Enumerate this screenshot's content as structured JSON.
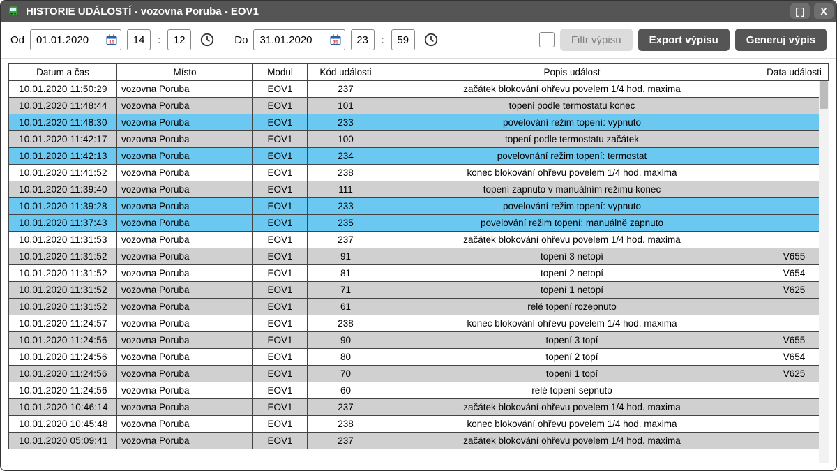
{
  "window": {
    "title": "HISTORIE UDÁLOSTÍ - vozovna Poruba - EOV1"
  },
  "toolbar": {
    "from_label": "Od",
    "from_date": "01.01.2020",
    "from_h": "14",
    "from_m": "12",
    "to_label": "Do",
    "to_date": "31.01.2020",
    "to_h": "23",
    "to_m": "59",
    "filter_label": "Filtr výpisu",
    "export_label": "Export výpisu",
    "generate_label": "Generuj výpis"
  },
  "columns": {
    "datetime": "Datum a čas",
    "place": "Místo",
    "module": "Modul",
    "code": "Kód události",
    "desc": "Popis událost",
    "data": "Data události"
  },
  "rows": [
    {
      "dt": "10.01.2020  11:50:29",
      "pl": "vozovna Poruba",
      "md": "EOV1",
      "cd": "237",
      "de": "začátek blokování ohřevu povelem 1/4 hod. maxima",
      "da": "",
      "hl": "none"
    },
    {
      "dt": "10.01.2020  11:48:44",
      "pl": "vozovna Poruba",
      "md": "EOV1",
      "cd": "101",
      "de": "topeni podle termostatu konec",
      "da": "",
      "hl": "band"
    },
    {
      "dt": "10.01.2020  11:48:30",
      "pl": "vozovna Poruba",
      "md": "EOV1",
      "cd": "233",
      "de": "povelování režim topení: vypnuto",
      "da": "",
      "hl": "blue"
    },
    {
      "dt": "10.01.2020  11:42:17",
      "pl": "vozovna Poruba",
      "md": "EOV1",
      "cd": "100",
      "de": "topení podle termostatu začátek",
      "da": "",
      "hl": "band"
    },
    {
      "dt": "10.01.2020  11:42:13",
      "pl": "vozovna Poruba",
      "md": "EOV1",
      "cd": "234",
      "de": "povelovnání režim topení: termostat",
      "da": "",
      "hl": "blue"
    },
    {
      "dt": "10.01.2020  11:41:52",
      "pl": "vozovna Poruba",
      "md": "EOV1",
      "cd": "238",
      "de": "konec blokování ohřevu povelem 1/4 hod. maxima",
      "da": "",
      "hl": "none"
    },
    {
      "dt": "10.01.2020  11:39:40",
      "pl": "vozovna Poruba",
      "md": "EOV1",
      "cd": "111",
      "de": "topení zapnuto v manuálním režimu konec",
      "da": "",
      "hl": "band"
    },
    {
      "dt": "10.01.2020  11:39:28",
      "pl": "vozovna Poruba",
      "md": "EOV1",
      "cd": "233",
      "de": "povelování režim topení: vypnuto",
      "da": "",
      "hl": "blue"
    },
    {
      "dt": "10.01.2020  11:37:43",
      "pl": "vozovna Poruba",
      "md": "EOV1",
      "cd": "235",
      "de": "povelování režim topení: manuálně zapnuto",
      "da": "",
      "hl": "blue"
    },
    {
      "dt": "10.01.2020  11:31:53",
      "pl": "vozovna Poruba",
      "md": "EOV1",
      "cd": "237",
      "de": "začátek blokování ohřevu povelem 1/4 hod. maxima",
      "da": "",
      "hl": "none"
    },
    {
      "dt": "10.01.2020  11:31:52",
      "pl": "vozovna Poruba",
      "md": "EOV1",
      "cd": "91",
      "de": "topení 3 netopí",
      "da": "V655",
      "hl": "band"
    },
    {
      "dt": "10.01.2020  11:31:52",
      "pl": "vozovna Poruba",
      "md": "EOV1",
      "cd": "81",
      "de": "topení 2 netopí",
      "da": "V654",
      "hl": "none"
    },
    {
      "dt": "10.01.2020  11:31:52",
      "pl": "vozovna Poruba",
      "md": "EOV1",
      "cd": "71",
      "de": "topení 1 netopí",
      "da": "V625",
      "hl": "band"
    },
    {
      "dt": "10.01.2020  11:31:52",
      "pl": "vozovna Poruba",
      "md": "EOV1",
      "cd": "61",
      "de": "relé topení rozepnuto",
      "da": "",
      "hl": "band"
    },
    {
      "dt": "10.01.2020  11:24:57",
      "pl": "vozovna Poruba",
      "md": "EOV1",
      "cd": "238",
      "de": "konec blokování ohřevu povelem 1/4 hod. maxima",
      "da": "",
      "hl": "none"
    },
    {
      "dt": "10.01.2020  11:24:56",
      "pl": "vozovna Poruba",
      "md": "EOV1",
      "cd": "90",
      "de": "topení 3 topí",
      "da": "V655",
      "hl": "band"
    },
    {
      "dt": "10.01.2020  11:24:56",
      "pl": "vozovna Poruba",
      "md": "EOV1",
      "cd": "80",
      "de": "topení 2 topí",
      "da": "V654",
      "hl": "none"
    },
    {
      "dt": "10.01.2020  11:24:56",
      "pl": "vozovna Poruba",
      "md": "EOV1",
      "cd": "70",
      "de": "topeni 1 topí",
      "da": "V625",
      "hl": "band"
    },
    {
      "dt": "10.01.2020  11:24:56",
      "pl": "vozovna Poruba",
      "md": "EOV1",
      "cd": "60",
      "de": "relé topení sepnuto",
      "da": "",
      "hl": "none"
    },
    {
      "dt": "10.01.2020  10:46:14",
      "pl": "vozovna Poruba",
      "md": "EOV1",
      "cd": "237",
      "de": "začátek blokování ohřevu povelem 1/4 hod. maxima",
      "da": "",
      "hl": "band"
    },
    {
      "dt": "10.01.2020  10:45:48",
      "pl": "vozovna Poruba",
      "md": "EOV1",
      "cd": "238",
      "de": "konec blokování ohřevu povelem 1/4 hod. maxima",
      "da": "",
      "hl": "none"
    },
    {
      "dt": "10.01.2020  05:09:41",
      "pl": "vozovna Poruba",
      "md": "EOV1",
      "cd": "237",
      "de": "začátek blokování ohřevu povelem 1/4 hod. maxima",
      "da": "",
      "hl": "band"
    }
  ]
}
